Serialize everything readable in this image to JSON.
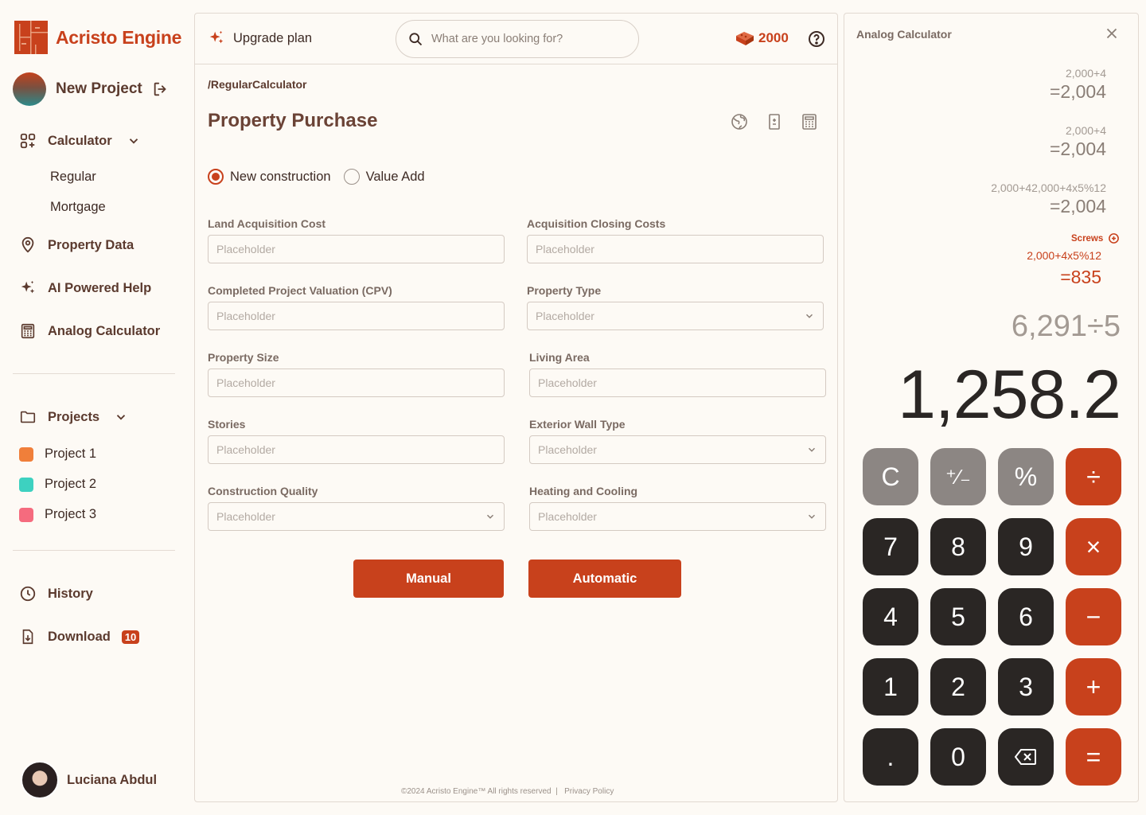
{
  "brand": {
    "name": "Acristo Engine"
  },
  "sidebar": {
    "project_title": "New Project",
    "calculator_label": "Calculator",
    "calculator_subitems": [
      "Regular",
      "Mortgage"
    ],
    "property_data_label": "Property Data",
    "ai_help_label": "AI Powered Help",
    "analog_calc_label": "Analog Calculator",
    "projects_label": "Projects",
    "projects": [
      {
        "name": "Project 1",
        "color": "#f07f3a"
      },
      {
        "name": "Project 2",
        "color": "#3dd1c0"
      },
      {
        "name": "Project 3",
        "color": "#f56b7e"
      }
    ],
    "history_label": "History",
    "download_label": "Download",
    "download_count": "10",
    "user_name": "Luciana Abdul"
  },
  "topbar": {
    "upgrade_label": "Upgrade plan",
    "search_placeholder": "What are you looking for?",
    "credits": "2000"
  },
  "main": {
    "breadcrumb": "/RegularCalculator",
    "title": "Property Purchase",
    "radio_options": [
      "New construction",
      "Value Add"
    ],
    "radio_selected": "New construction",
    "fields": [
      {
        "label": "Land Acquisition Cost",
        "placeholder": "Placeholder",
        "type": "input"
      },
      {
        "label": "Acquisition Closing Costs",
        "placeholder": "Placeholder",
        "type": "input"
      },
      {
        "label": "Completed Project Valuation (CPV)",
        "placeholder": "Placeholder",
        "type": "input"
      },
      {
        "label": "Property Type",
        "placeholder": "Placeholder",
        "type": "select"
      },
      {
        "label": "Property Size",
        "placeholder": "Placeholder",
        "type": "input"
      },
      {
        "label": "Living Area",
        "placeholder": "Placeholder",
        "type": "input"
      },
      {
        "label": "Stories",
        "placeholder": "Placeholder",
        "type": "input"
      },
      {
        "label": "Exterior Wall Type",
        "placeholder": "Placeholder",
        "type": "select"
      },
      {
        "label": "Construction Quality",
        "placeholder": "Placeholder",
        "type": "select"
      },
      {
        "label": "Heating and Cooling",
        "placeholder": "Placeholder",
        "type": "select"
      }
    ],
    "manual_label": "Manual",
    "automatic_label": "Automatic",
    "footer_copyright": "©2024 Acristo Engine™ All rights reserved",
    "footer_privacy": "Privacy Policy"
  },
  "calculator": {
    "title": "Analog Calculator",
    "history": [
      {
        "expr": "2,000+4",
        "result": "=2,004"
      },
      {
        "expr": "2,000+4",
        "result": "=2,004"
      },
      {
        "expr": "2,000+42,000+4x5%12",
        "result": "=2,004"
      }
    ],
    "tagged_label": "Screws",
    "tagged_expr": "2,000+4x5%12",
    "tagged_result": "=835",
    "current_expr": "6,291÷5",
    "current_value": "1,258.2",
    "keys": [
      [
        "C",
        "⁺∕₋",
        "%",
        "÷"
      ],
      [
        "7",
        "8",
        "9",
        "×"
      ],
      [
        "4",
        "5",
        "6",
        "−"
      ],
      [
        "1",
        "2",
        "3",
        "+"
      ],
      [
        ".",
        "0",
        "⌫",
        "="
      ]
    ]
  },
  "colors": {
    "accent": "#c8411c",
    "text": "#5b3a2e",
    "background": "#fdfaf5"
  }
}
